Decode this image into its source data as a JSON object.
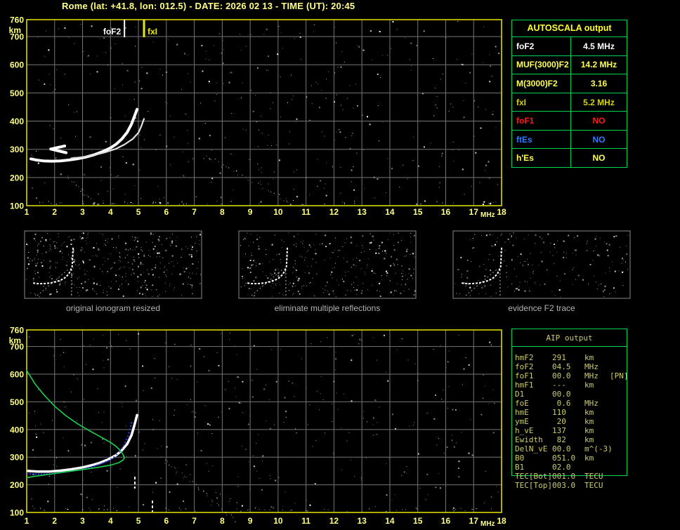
{
  "window": {
    "title": "Rome (lat: +41.8, lon: 012.5) - DATE: 2026 02 13 - TIME (UT): 20:45"
  },
  "colors": {
    "background": "#000000",
    "axis_yellow": "#d9d900",
    "label_yellow": "#ffff80",
    "grid_gray": "#757575",
    "table_green": "#00d455",
    "autoscala_title_yellow": "#ffff2e",
    "aip_text": "#cccc66",
    "thumb_border": "#8a8a8a",
    "caption_gray": "#b2b2b2",
    "profile_green": "#19d24e",
    "fitted_blue": "#2b46ff",
    "trace_white": "#ffffff"
  },
  "top_plot": {
    "y_unit": "km",
    "x_unit": "MHz",
    "y_ticks": [
      760,
      700,
      600,
      500,
      400,
      300,
      200,
      100
    ],
    "x_ticks": [
      1,
      2,
      3,
      4,
      5,
      6,
      7,
      8,
      9,
      10,
      11,
      12,
      13,
      14,
      15,
      16,
      17,
      18
    ],
    "markers": [
      {
        "label": "foF2",
        "freq_mhz": 4.5,
        "color": "#ffffff"
      },
      {
        "label": "fxI",
        "freq_mhz": 5.2,
        "color": "#e8e800"
      }
    ]
  },
  "bottom_plot": {
    "y_unit": "km",
    "x_unit": "MHz",
    "y_ticks": [
      760,
      700,
      600,
      500,
      400,
      300,
      200,
      100
    ],
    "x_ticks": [
      1,
      2,
      3,
      4,
      5,
      6,
      7,
      8,
      9,
      10,
      11,
      12,
      13,
      14,
      15,
      16,
      17,
      18
    ]
  },
  "autoscala_table": {
    "title": "AUTOSCALA output",
    "rows": [
      {
        "label": "foF2",
        "value": "4.5 MHz",
        "color": "#ffffff"
      },
      {
        "label": "MUF(3000)F2",
        "value": "14.2 MHz",
        "color": "#ffff55"
      },
      {
        "label": "M(3000)F2",
        "value": "3.16",
        "color": "#ffff55"
      },
      {
        "label": "fxI",
        "value": "5.2 MHz",
        "color": "#d6d600"
      },
      {
        "label": "foF1",
        "value": "NO",
        "color": "#ff1a1a"
      },
      {
        "label": "ftEs",
        "value": "NO",
        "color": "#2e7bff"
      },
      {
        "label": "h'Es",
        "value": "NO",
        "color": "#ffff55"
      }
    ]
  },
  "aip_table": {
    "title": "AIP output",
    "rows": [
      {
        "label": "hmF2",
        "value": "291",
        "unit": "km",
        "extra": ""
      },
      {
        "label": "foF2",
        "value": "04.5",
        "unit": "MHz",
        "extra": ""
      },
      {
        "label": "foF1",
        "value": "00.0",
        "unit": "MHz",
        "extra": "[PN]"
      },
      {
        "label": "hmF1",
        "value": "---",
        "unit": "km",
        "extra": ""
      },
      {
        "label": "D1",
        "value": "00.0",
        "unit": "",
        "extra": ""
      },
      {
        "label": "foE",
        "value": " 0.6",
        "unit": "MHz",
        "extra": ""
      },
      {
        "label": "hmE",
        "value": "110",
        "unit": "km",
        "extra": ""
      },
      {
        "label": "ymE",
        "value": " 20",
        "unit": "km",
        "extra": ""
      },
      {
        "label": "h_vE",
        "value": "137",
        "unit": "km",
        "extra": ""
      },
      {
        "label": "Ewidth",
        "value": " 82",
        "unit": "km",
        "extra": ""
      },
      {
        "label": "DelN_vE",
        "value": "00.0",
        "unit": "m^(-3)",
        "extra": ""
      },
      {
        "label": "B0",
        "value": "051.0",
        "unit": "km",
        "extra": ""
      },
      {
        "label": "B1",
        "value": "02.0",
        "unit": "",
        "extra": ""
      },
      {
        "label": "TEC[Bot]",
        "value": "001.0",
        "unit": "TECU",
        "extra": ""
      },
      {
        "label": "TEC[Top]",
        "value": "003.0",
        "unit": "TECU",
        "extra": ""
      }
    ]
  },
  "thumbnails": [
    {
      "caption": "original ionogram resized"
    },
    {
      "caption": "eliminate multiple reflections"
    },
    {
      "caption": "evidence F2 trace"
    }
  ],
  "chart_data": [
    {
      "id": "ionogram_top",
      "type": "scatter",
      "title": "scaled ionogram",
      "xlabel": "MHz",
      "ylabel": "km",
      "xlim": [
        1,
        18
      ],
      "ylim": [
        100,
        760
      ],
      "grid": true,
      "annotations": [
        {
          "label": "foF2",
          "x": 4.5
        },
        {
          "label": "fxI",
          "x": 5.2
        }
      ],
      "series": [
        {
          "name": "F2-trace-O-mode",
          "color": "#ffffff",
          "width": 4,
          "points": [
            [
              1.15,
              266
            ],
            [
              1.35,
              262
            ],
            [
              1.6,
              259
            ],
            [
              1.9,
              258
            ],
            [
              2.2,
              259
            ],
            [
              2.5,
              262
            ],
            [
              2.8,
              266
            ],
            [
              3.1,
              272
            ],
            [
              3.4,
              280
            ],
            [
              3.7,
              291
            ],
            [
              4.0,
              305
            ],
            [
              4.2,
              318
            ],
            [
              4.4,
              336
            ],
            [
              4.6,
              361
            ],
            [
              4.75,
              389
            ],
            [
              4.85,
              415
            ],
            [
              4.95,
              442
            ]
          ]
        },
        {
          "name": "F2-trace-X-mode",
          "color": "#e0e0e0",
          "width": 2.2,
          "points": [
            [
              2.6,
              268
            ],
            [
              3.0,
              272
            ],
            [
              3.4,
              279
            ],
            [
              3.8,
              289
            ],
            [
              4.2,
              302
            ],
            [
              4.5,
              317
            ],
            [
              4.8,
              337
            ],
            [
              5.0,
              359
            ],
            [
              5.1,
              381
            ],
            [
              5.2,
              408
            ]
          ]
        },
        {
          "name": "spread-echo",
          "color": "#ffffff",
          "width": 4,
          "points": [
            [
              2.36,
              312
            ],
            [
              1.86,
              301
            ],
            [
              2.41,
              288
            ]
          ]
        }
      ]
    },
    {
      "id": "profile_bottom",
      "type": "line",
      "title": "AIP electron density profile",
      "xlabel": "MHz",
      "ylabel": "km",
      "xlim": [
        1,
        18
      ],
      "ylim": [
        100,
        760
      ],
      "grid": true,
      "series": [
        {
          "name": "measured-trace",
          "color": "#ffffff",
          "width": 3.5,
          "points": [
            [
              1.05,
              250
            ],
            [
              1.4,
              248
            ],
            [
              1.8,
              248
            ],
            [
              2.2,
              251
            ],
            [
              2.6,
              256
            ],
            [
              3.0,
              263
            ],
            [
              3.3,
              270
            ],
            [
              3.6,
              279
            ],
            [
              3.9,
              291
            ],
            [
              4.2,
              307
            ],
            [
              4.4,
              324
            ],
            [
              4.6,
              348
            ],
            [
              4.75,
              379
            ],
            [
              4.85,
              413
            ],
            [
              4.95,
              452
            ]
          ]
        },
        {
          "name": "fitted-trace",
          "color": "#2b46ff",
          "width": 2,
          "style": "dotted",
          "points": [
            [
              1.0,
              243
            ],
            [
              1.4,
              241
            ],
            [
              1.8,
              242
            ],
            [
              2.2,
              246
            ],
            [
              2.6,
              252
            ],
            [
              3.0,
              259
            ],
            [
              3.3,
              267
            ],
            [
              3.6,
              277
            ],
            [
              3.9,
              290
            ],
            [
              4.1,
              303
            ],
            [
              4.3,
              322
            ],
            [
              4.45,
              345
            ],
            [
              4.6,
              378
            ],
            [
              4.7,
              415
            ],
            [
              4.75,
              438
            ]
          ]
        },
        {
          "name": "electron-density-profile",
          "color": "#19d24e",
          "width": 1.6,
          "points": [
            [
              1.0,
              613
            ],
            [
              1.3,
              565
            ],
            [
              1.6,
              527
            ],
            [
              2.0,
              484
            ],
            [
              2.4,
              450
            ],
            [
              2.8,
              422
            ],
            [
              3.2,
              398
            ],
            [
              3.6,
              376
            ],
            [
              4.0,
              353
            ],
            [
              4.2,
              339
            ],
            [
              4.35,
              324
            ],
            [
              4.45,
              309
            ],
            [
              4.5,
              298
            ],
            [
              4.45,
              290
            ],
            [
              4.3,
              280
            ],
            [
              4.0,
              271
            ],
            [
              3.6,
              264
            ],
            [
              3.2,
              258
            ],
            [
              2.8,
              252
            ],
            [
              2.4,
              247
            ],
            [
              2.0,
              241
            ],
            [
              1.6,
              235
            ],
            [
              1.3,
              231
            ],
            [
              1.0,
              226
            ]
          ]
        }
      ]
    }
  ]
}
